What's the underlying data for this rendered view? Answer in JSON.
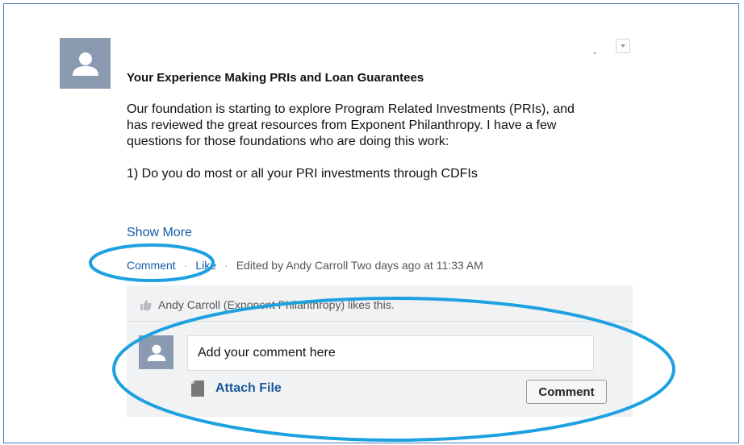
{
  "post": {
    "title": "Your Experience Making PRIs and Loan Guarantees",
    "body": [
      "Our foundation is starting to explore Program Related Investments (PRIs), and has reviewed the great resources from Exponent Philanthropy. I have a few questions for those foundations who are doing this work:",
      "1) Do you do most or all your PRI investments through CDFIs"
    ],
    "show_more": "Show More"
  },
  "actions": {
    "comment": "Comment",
    "separator": "·",
    "like": "Like",
    "edited": "Edited by Andy Carroll Two days ago at 11:33 AM"
  },
  "feedback": {
    "likes_text": "Andy Carroll (Exponent Philanthropy) likes this.",
    "comment_placeholder": "Add your comment here",
    "attach_label": "Attach File",
    "comment_button": "Comment"
  },
  "icons": {
    "avatar": "user-icon",
    "like": "thumbs-up-icon",
    "attach": "file-icon",
    "menu": "dropdown-arrow-icon"
  },
  "colors": {
    "link": "#0f5ba7",
    "avatar_bg": "#8a9bb1",
    "annotation": "#1da1e0",
    "feedback_bg": "#f1f2f4"
  }
}
